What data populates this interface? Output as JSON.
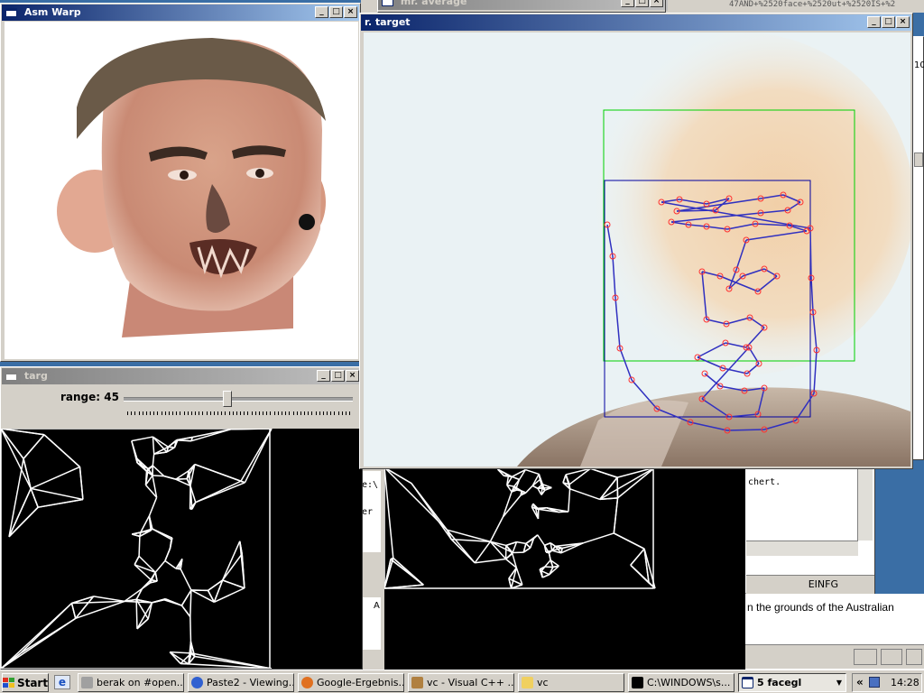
{
  "windows": {
    "asm_warp": {
      "title": "Asm Warp"
    },
    "mr_average": {
      "title": "mr. average"
    },
    "mr_target": {
      "title": "r. target"
    },
    "targ": {
      "title": "targ",
      "slider_label": "range: 45",
      "slider_value": 45
    },
    "bg_console": {
      "fragment1": "e:\\",
      "fragment2": "er"
    },
    "bg_editor": {
      "text_fragment": "chert.",
      "status": "EINFG"
    },
    "bg_browser": {
      "text_fragment": "n the grounds of the Australian"
    },
    "bg_right": {
      "fragment": "10"
    },
    "bg_misc": {
      "frag_a": "A"
    }
  },
  "top_edge": {
    "url_fragment": "47AND+%2520face+%2520ut+%2520IS+%2"
  },
  "taskbar": {
    "start_label": "Start",
    "items": [
      {
        "label": "berak on #open..."
      },
      {
        "label": "Paste2 - Viewing..."
      },
      {
        "label": "Google-Ergebnis..."
      },
      {
        "label": "vc - Visual C++ ..."
      },
      {
        "label": "vc"
      },
      {
        "label": "C:\\WINDOWS\\s..."
      },
      {
        "label": "5 facegl"
      }
    ],
    "tray_chevron": "«",
    "clock": "14:28"
  },
  "colors": {
    "desktop": "#3a6ea5",
    "title_active": "#0a246a",
    "face_box": "#00d000",
    "shape_box": "#0000a0",
    "landmark": "#ff3030",
    "mesh": "#ffffff"
  }
}
